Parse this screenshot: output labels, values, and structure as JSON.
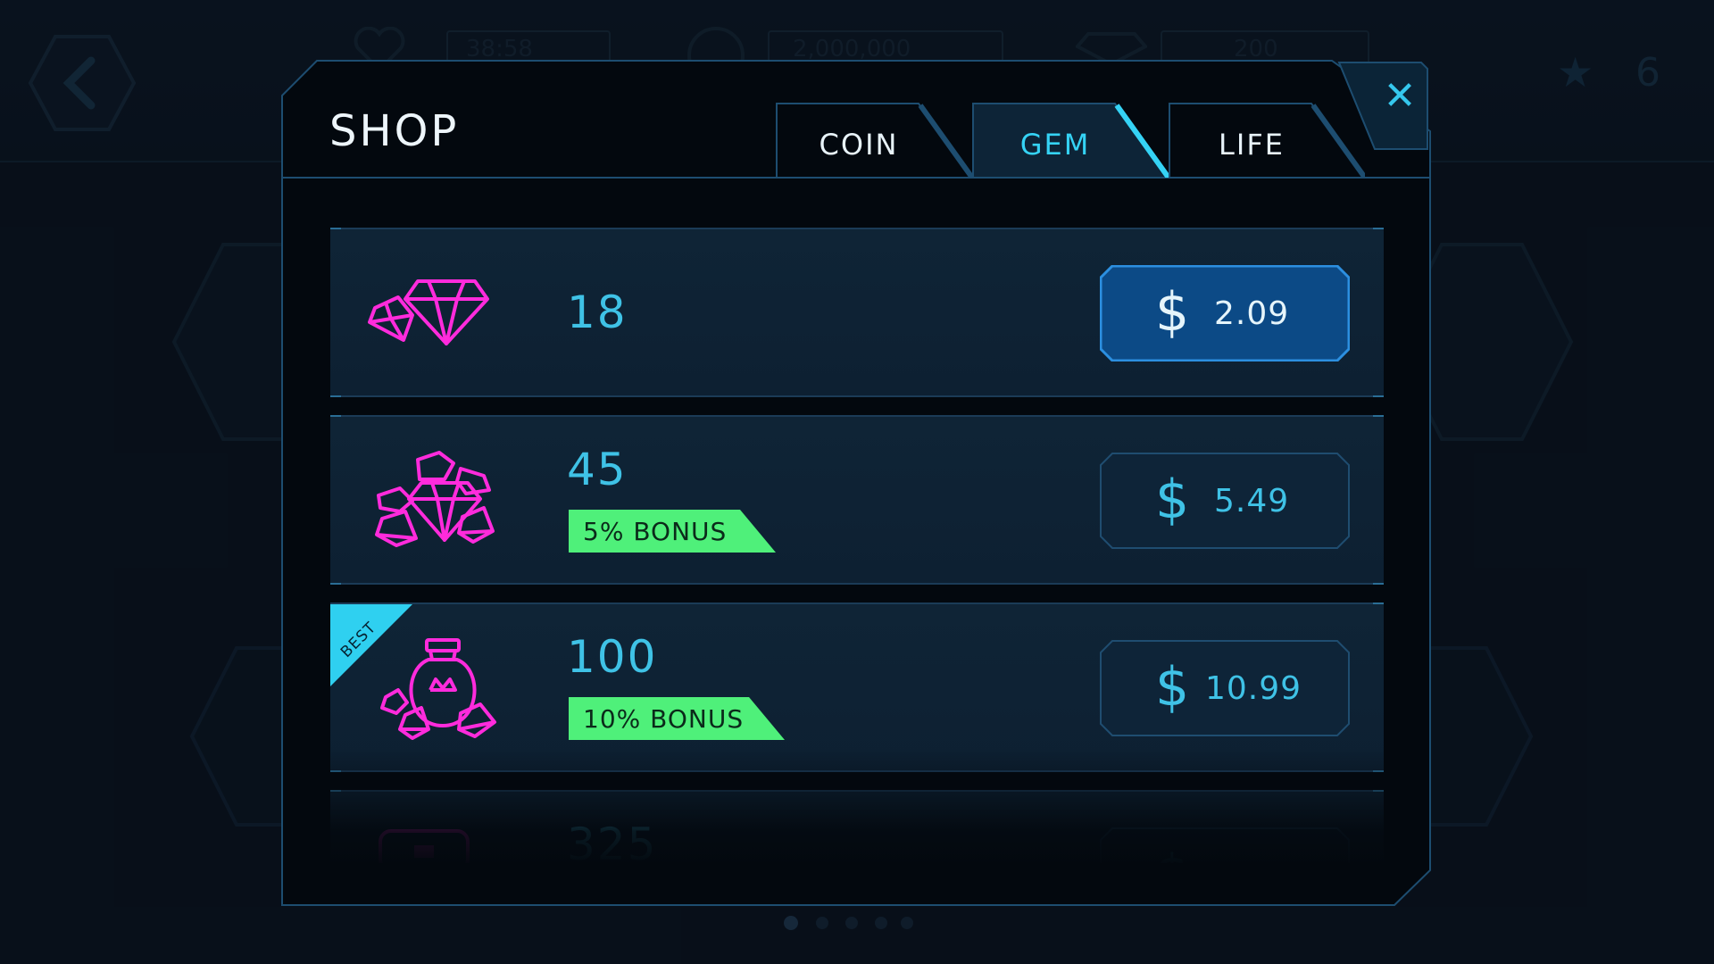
{
  "hud": {
    "lives": "38:58",
    "coins": "2,000,000",
    "gems": "200",
    "stars": "6"
  },
  "shop": {
    "title": "SHOP",
    "close_icon": "close-icon",
    "tabs": [
      {
        "label": "COIN",
        "active": false
      },
      {
        "label": "GEM",
        "active": true
      },
      {
        "label": "LIFE",
        "active": false
      }
    ],
    "items": [
      {
        "amount": "18",
        "bonus": "",
        "price": "2.09",
        "currency": "$",
        "icon": "gem-pile-small-icon",
        "highlighted": true,
        "best": false
      },
      {
        "amount": "45",
        "bonus": "5% BONUS",
        "price": "5.49",
        "currency": "$",
        "icon": "gem-pile-medium-icon",
        "highlighted": false,
        "best": false
      },
      {
        "amount": "100",
        "bonus": "10% BONUS",
        "price": "10.99",
        "currency": "$",
        "icon": "gem-bag-icon",
        "highlighted": false,
        "best": true,
        "badge": "BEST"
      },
      {
        "amount": "325",
        "bonus": "",
        "price": "",
        "currency": "$",
        "icon": "gem-chest-icon",
        "highlighted": false,
        "best": false
      }
    ]
  },
  "colors": {
    "accent": "#35d3f5",
    "gem": "#ff2bdc",
    "bonus": "#4ff07a",
    "panel": "#03080e"
  }
}
